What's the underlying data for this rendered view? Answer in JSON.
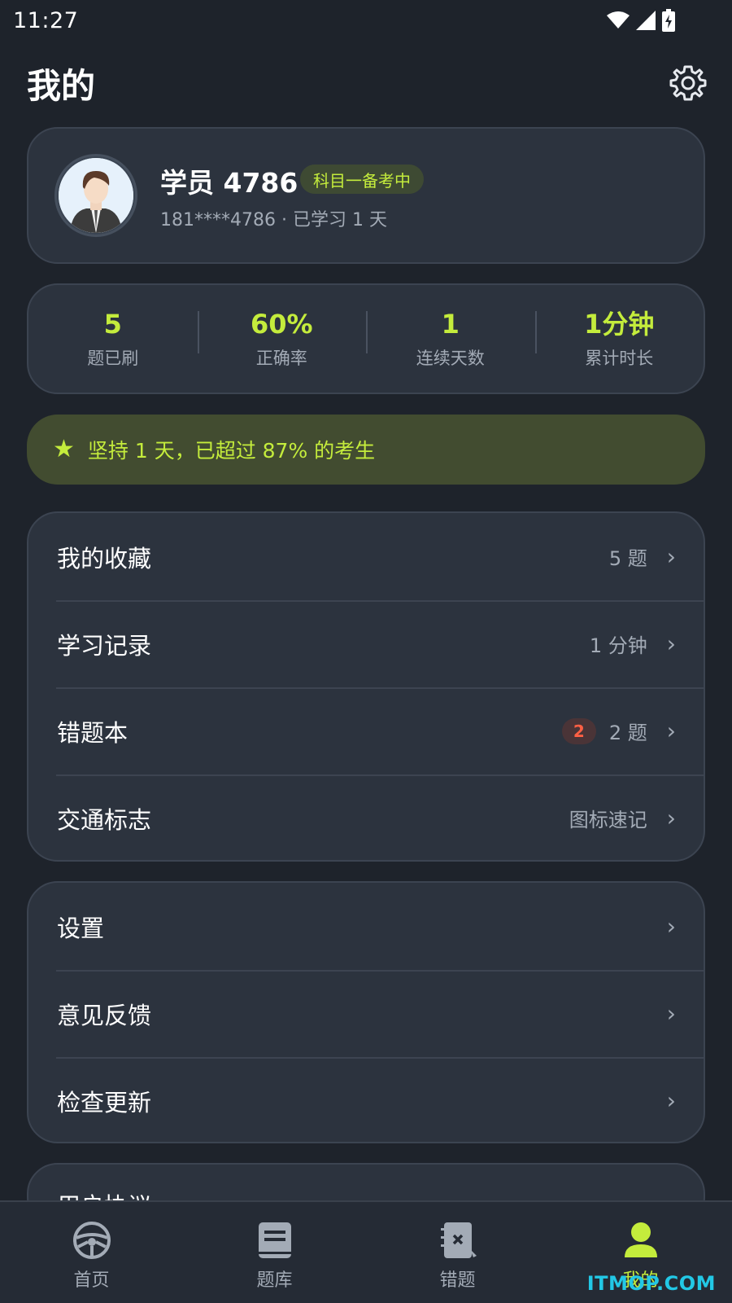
{
  "status_bar": {
    "time": "11:27"
  },
  "header": {
    "title": "我的"
  },
  "profile": {
    "name": "学员 4786",
    "tag": "科目一备考中",
    "subtitle": "181****4786 · 已学习 1 天"
  },
  "stats": [
    {
      "value": "5",
      "label": "题已刷"
    },
    {
      "value": "60%",
      "label": "正确率"
    },
    {
      "value": "1",
      "label": "连续天数"
    },
    {
      "value": "1分钟",
      "label": "累计时长"
    }
  ],
  "banner": {
    "text": "坚持 1 天，已超过 87% 的考生"
  },
  "menu_group_1": [
    {
      "label": "我的收藏",
      "value": "5 题"
    },
    {
      "label": "学习记录",
      "value": "1 分钟"
    },
    {
      "label": "错题本",
      "badge": "2",
      "value": "2 题"
    },
    {
      "label": "交通标志",
      "value": "图标速记"
    }
  ],
  "menu_group_2": [
    {
      "label": "设置"
    },
    {
      "label": "意见反馈"
    },
    {
      "label": "检查更新"
    }
  ],
  "menu_group_3": {
    "partial_label": "用户协议"
  },
  "chevron": "›",
  "tabs": [
    {
      "label": "首页",
      "icon": "steering-wheel-icon"
    },
    {
      "label": "题库",
      "icon": "book-icon"
    },
    {
      "label": "错题",
      "icon": "wrong-notebook-icon"
    },
    {
      "label": "我的",
      "icon": "user-icon"
    }
  ],
  "watermark": "ITMOP.COM",
  "colors": {
    "background": "#1e232b",
    "card": "#2c333e",
    "accent": "#c4ec3c",
    "badge_red": "#ff6044"
  }
}
